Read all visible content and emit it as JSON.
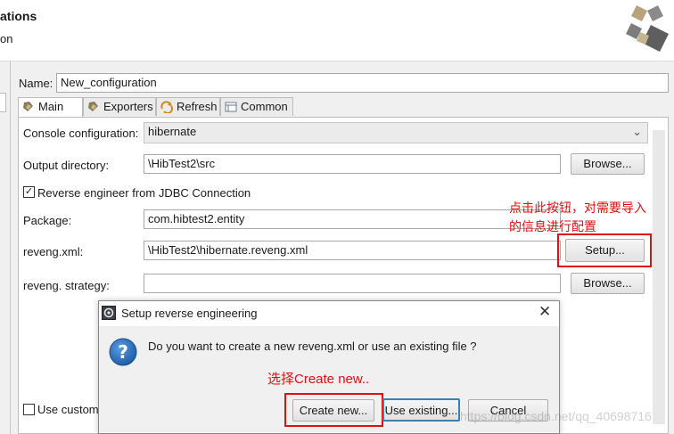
{
  "header": {
    "title_fragment": "ations",
    "subtitle_fragment": "on",
    "logo_icon": "hibernate-logo-icon"
  },
  "name_field": {
    "label": "Name:",
    "value": "New_configuration"
  },
  "tabs": [
    {
      "label": "Main",
      "icon": "main-tab-icon"
    },
    {
      "label": "Exporters",
      "icon": "exporters-tab-icon"
    },
    {
      "label": "Refresh",
      "icon": "refresh-tab-icon"
    },
    {
      "label": "Common",
      "icon": "common-tab-icon"
    }
  ],
  "form": {
    "console_label": "Console configuration:",
    "console_value": "hibernate",
    "output_label": "Output directory:",
    "output_value": "\\HibTest2\\src",
    "output_browse": "Browse...",
    "reverse_label": "Reverse engineer from JDBC Connection",
    "reverse_checked": true,
    "package_label": "Package:",
    "package_value": "com.hibtest2.entity",
    "reveng_label": "reveng.xml:",
    "reveng_value": "\\HibTest2\\hibernate.reveng.xml",
    "setup_button": "Setup...",
    "strategy_label": "reveng. strategy:",
    "strategy_value": "",
    "strategy_browse": "Browse...",
    "use_custom_label": "Use custom"
  },
  "annotations": {
    "setup_note_line1": "点击此按钮，对需要导入",
    "setup_note_line2": "的信息进行配置",
    "create_note": "选择Create new.."
  },
  "dialog": {
    "title": "Setup reverse engineering",
    "message": "Do you want to create a new reveng.xml or use an existing file ?",
    "create_button": "Create new...",
    "existing_button": "Use existing...",
    "cancel_button": "Cancel",
    "close_icon": "close-icon",
    "question_icon": "question-icon"
  },
  "watermark": "https://blog.csdn.net/qq_40698716",
  "colors": {
    "annotation_red": "#e01010",
    "question_blue": "#1f5fa8",
    "focus_blue": "#3c7fb1"
  }
}
